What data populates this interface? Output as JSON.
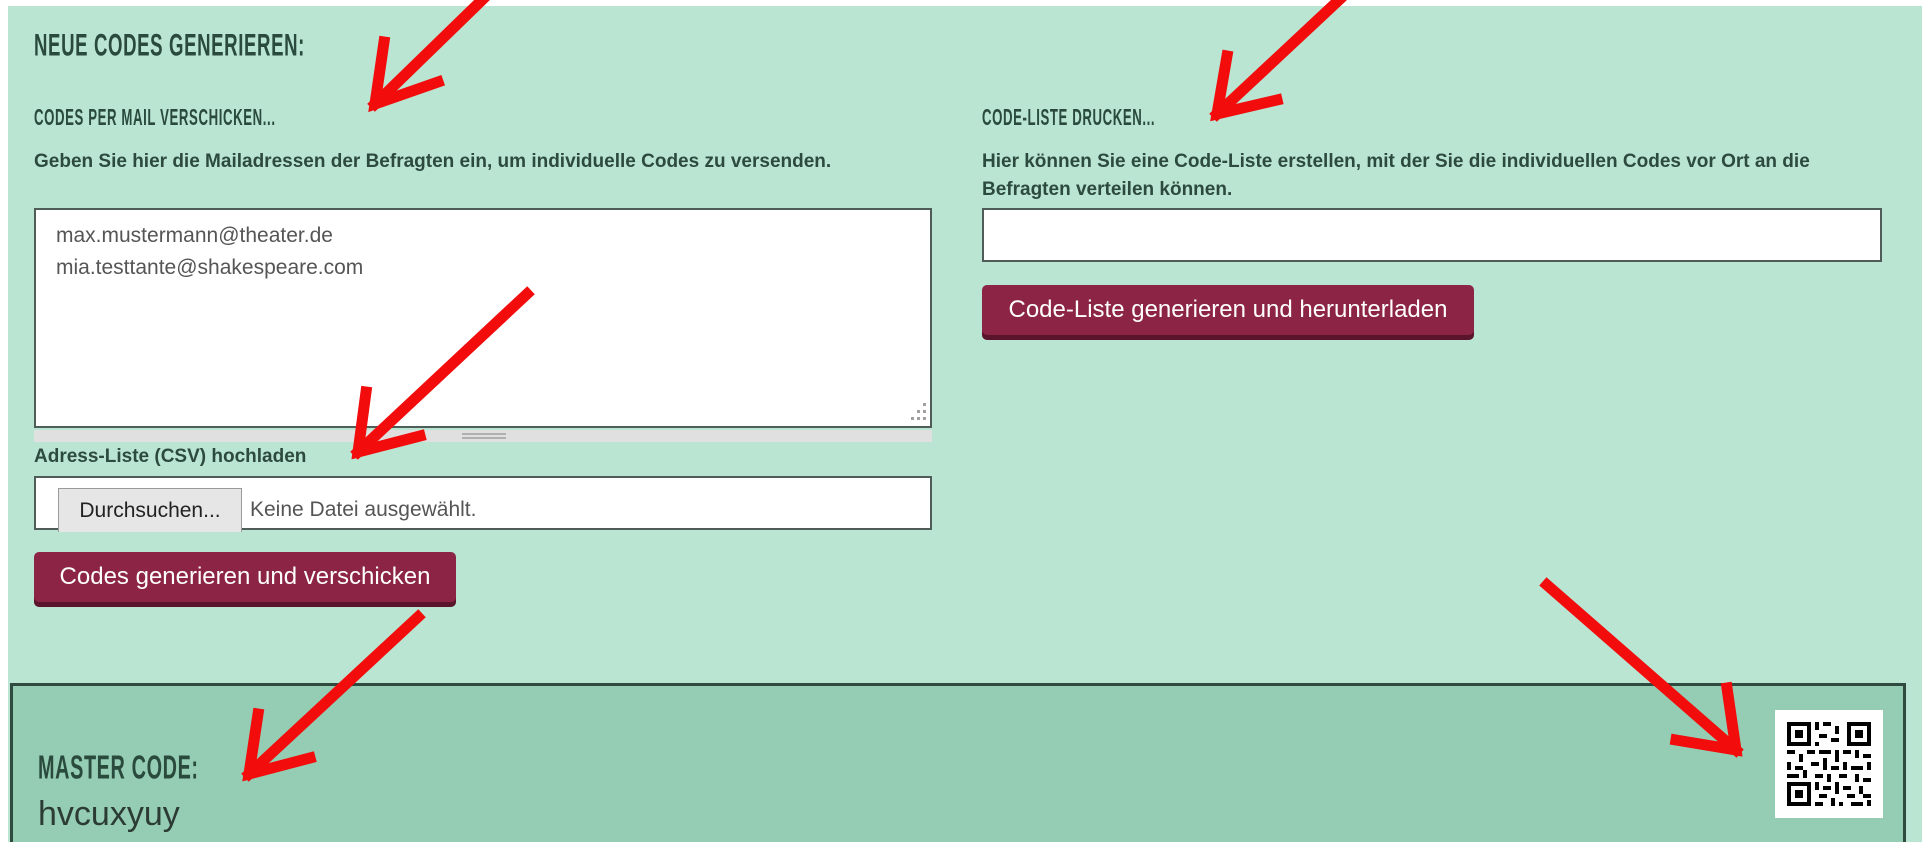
{
  "heading": "NEUE CODES GENERIEREN:",
  "mail": {
    "title": "CODES PER MAIL VERSCHICKEN...",
    "description": "Geben Sie hier die Mailadressen der Befragten ein, um individuelle Codes zu versenden.",
    "addresses": [
      "max.mustermann@theater.de",
      "mia.testtante@shakespeare.com"
    ],
    "csv_label": "Adress-Liste (CSV) hochladen",
    "file_button": "Durchsuchen...",
    "file_status": "Keine Datei ausgewählt.",
    "submit_label": "Codes generieren und verschicken"
  },
  "print": {
    "title": "CODE-LISTE DRUCKEN...",
    "description": "Hier können Sie eine Code-Liste erstellen, mit der Sie die individuellen Codes vor Ort an die Befragten verteilen können.",
    "input_value": "",
    "submit_label": "Code-Liste generieren und herunterladen"
  },
  "master": {
    "title": "MASTER CODE:",
    "code": "hvcuxyuy",
    "qr_icon": "qr-code-icon"
  },
  "colors": {
    "panel_bg": "#bae5d3",
    "master_bg": "#94cdb3",
    "button_bg": "#8c2446",
    "annotation_arrow": "#f20c0c"
  }
}
